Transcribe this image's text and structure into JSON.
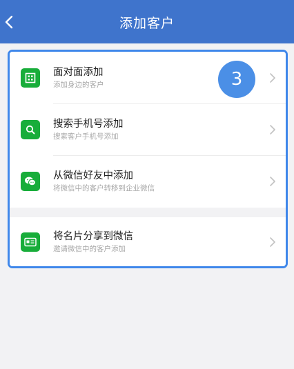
{
  "header": {
    "title": "添加客户",
    "back_icon": "chevron-left-icon",
    "background": "#3f74cc"
  },
  "highlight": {
    "border_color": "#3f87ea"
  },
  "items": [
    {
      "title": "面对面添加",
      "subtitle": "添加身边的客户",
      "icon": "qr-code-icon"
    },
    {
      "title": "搜索手机号添加",
      "subtitle": "搜索客户手机号添加",
      "icon": "search-icon"
    },
    {
      "title": "从微信好友中添加",
      "subtitle": "将微信中的客户转移到企业微信",
      "icon": "wechat-icon"
    },
    {
      "title": "将名片分享到微信",
      "subtitle": "邀请微信中的客户添加",
      "icon": "business-card-icon"
    }
  ],
  "icon_color": "#18ad3a",
  "step_badge": {
    "label": "3",
    "color": "#4b8fe6"
  }
}
